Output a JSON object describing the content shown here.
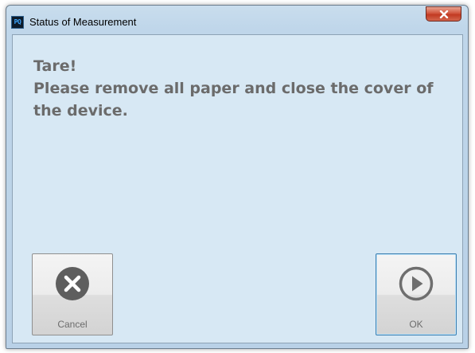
{
  "window": {
    "title": "Status of Measurement",
    "app_icon_text": "PQ",
    "close_glyph": "x"
  },
  "message": {
    "line1": "Tare!",
    "line2": "Please remove all paper and close the cover of the device."
  },
  "buttons": {
    "cancel_label": "Cancel",
    "ok_label": "OK"
  },
  "icons": {
    "cancel": "close-circle-icon",
    "ok": "play-circle-icon",
    "close": "close-icon"
  },
  "colors": {
    "client_background": "#d7e8f4",
    "message_text": "#6b6b6b",
    "cancel_icon": "#5e5e5e",
    "ok_icon": "#6e6e6e",
    "close_button": "#c94a32",
    "ok_border": "#3c7fb1"
  }
}
